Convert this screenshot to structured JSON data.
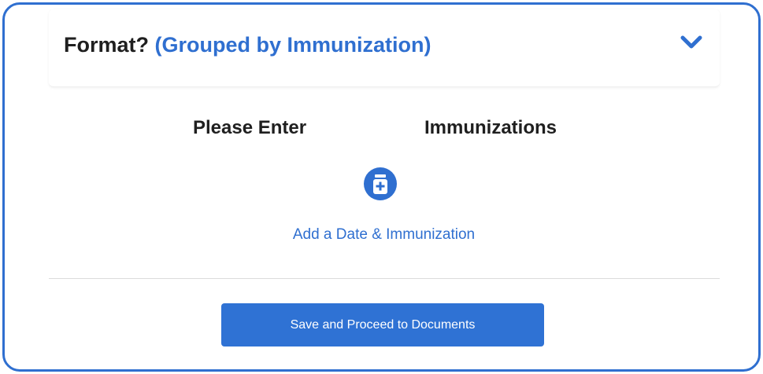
{
  "format": {
    "label": "Format?",
    "value": "(Grouped by Immunization)"
  },
  "heading": {
    "left": "Please Enter",
    "right": "Immunizations"
  },
  "add": {
    "icon": "medicine-bottle-plus-icon",
    "label": "Add a Date & Immunization"
  },
  "actions": {
    "save_label": "Save and Proceed to Documents"
  },
  "colors": {
    "accent": "#2f6fd0",
    "border": "#2f6fd0",
    "text": "#1f1f1f",
    "button": "#2f72d4"
  }
}
